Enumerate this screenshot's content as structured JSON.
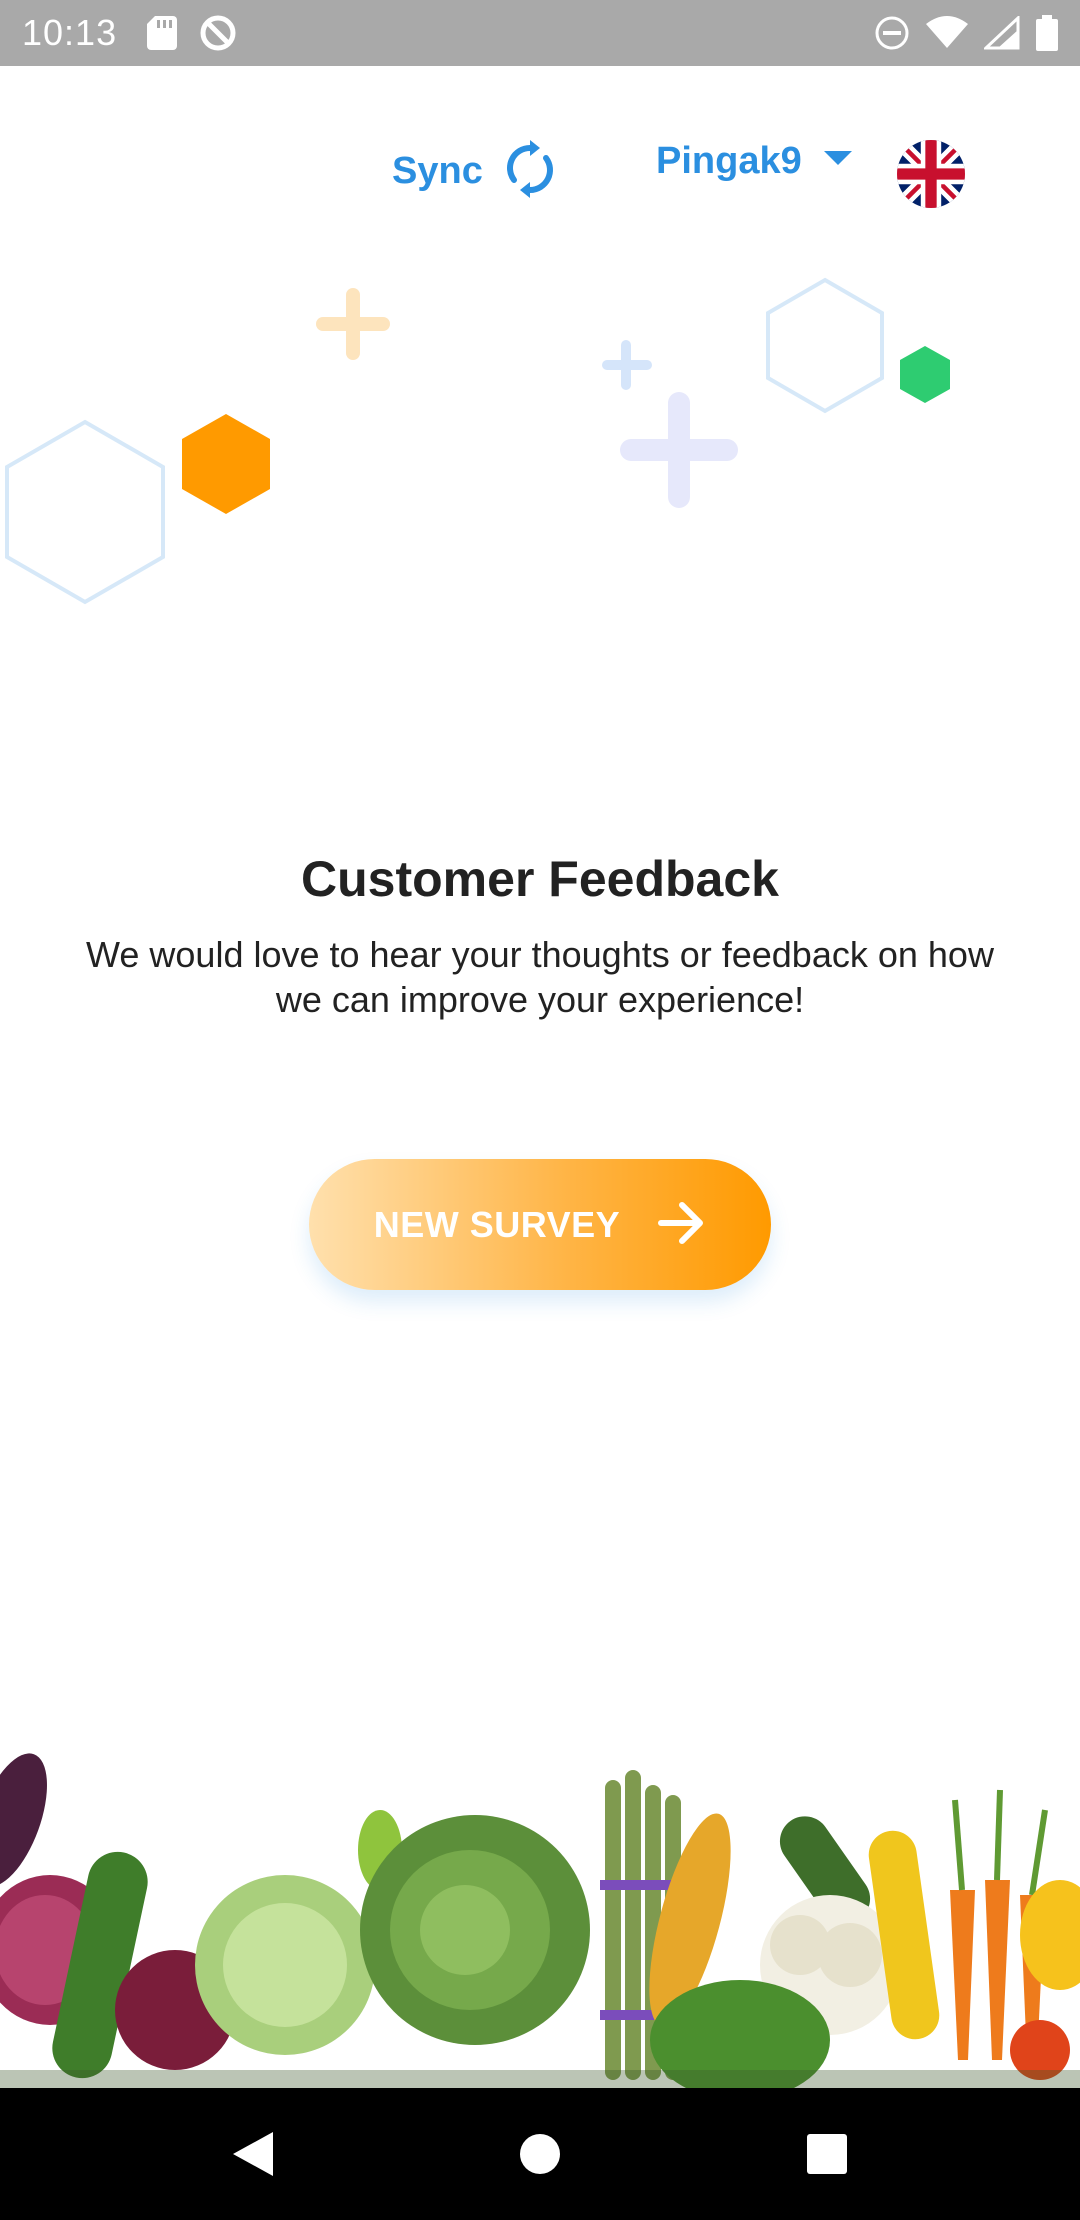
{
  "status_bar": {
    "time": "10:13",
    "icons": [
      "sd-card-icon",
      "data-saver-icon",
      "do-not-disturb-icon",
      "wifi-icon",
      "signal-icon",
      "battery-icon"
    ]
  },
  "header": {
    "sync_label": "Sync",
    "user_label": "Pingak9",
    "language_flag": "uk-flag-icon"
  },
  "main": {
    "title": "Customer Feedback",
    "subtitle": "We would love to hear your thoughts or feedback on how we can improve your experience!",
    "button_label": "NEW SURVEY"
  },
  "colors": {
    "accent_blue": "#2b8fe0",
    "button_orange": "#ff9a00",
    "button_light": "#ffe0ad",
    "text_dark": "#222222",
    "decor_green": "#2ecc71"
  },
  "nav_bar": {
    "icons": [
      "back-icon",
      "home-icon",
      "recents-icon"
    ]
  }
}
